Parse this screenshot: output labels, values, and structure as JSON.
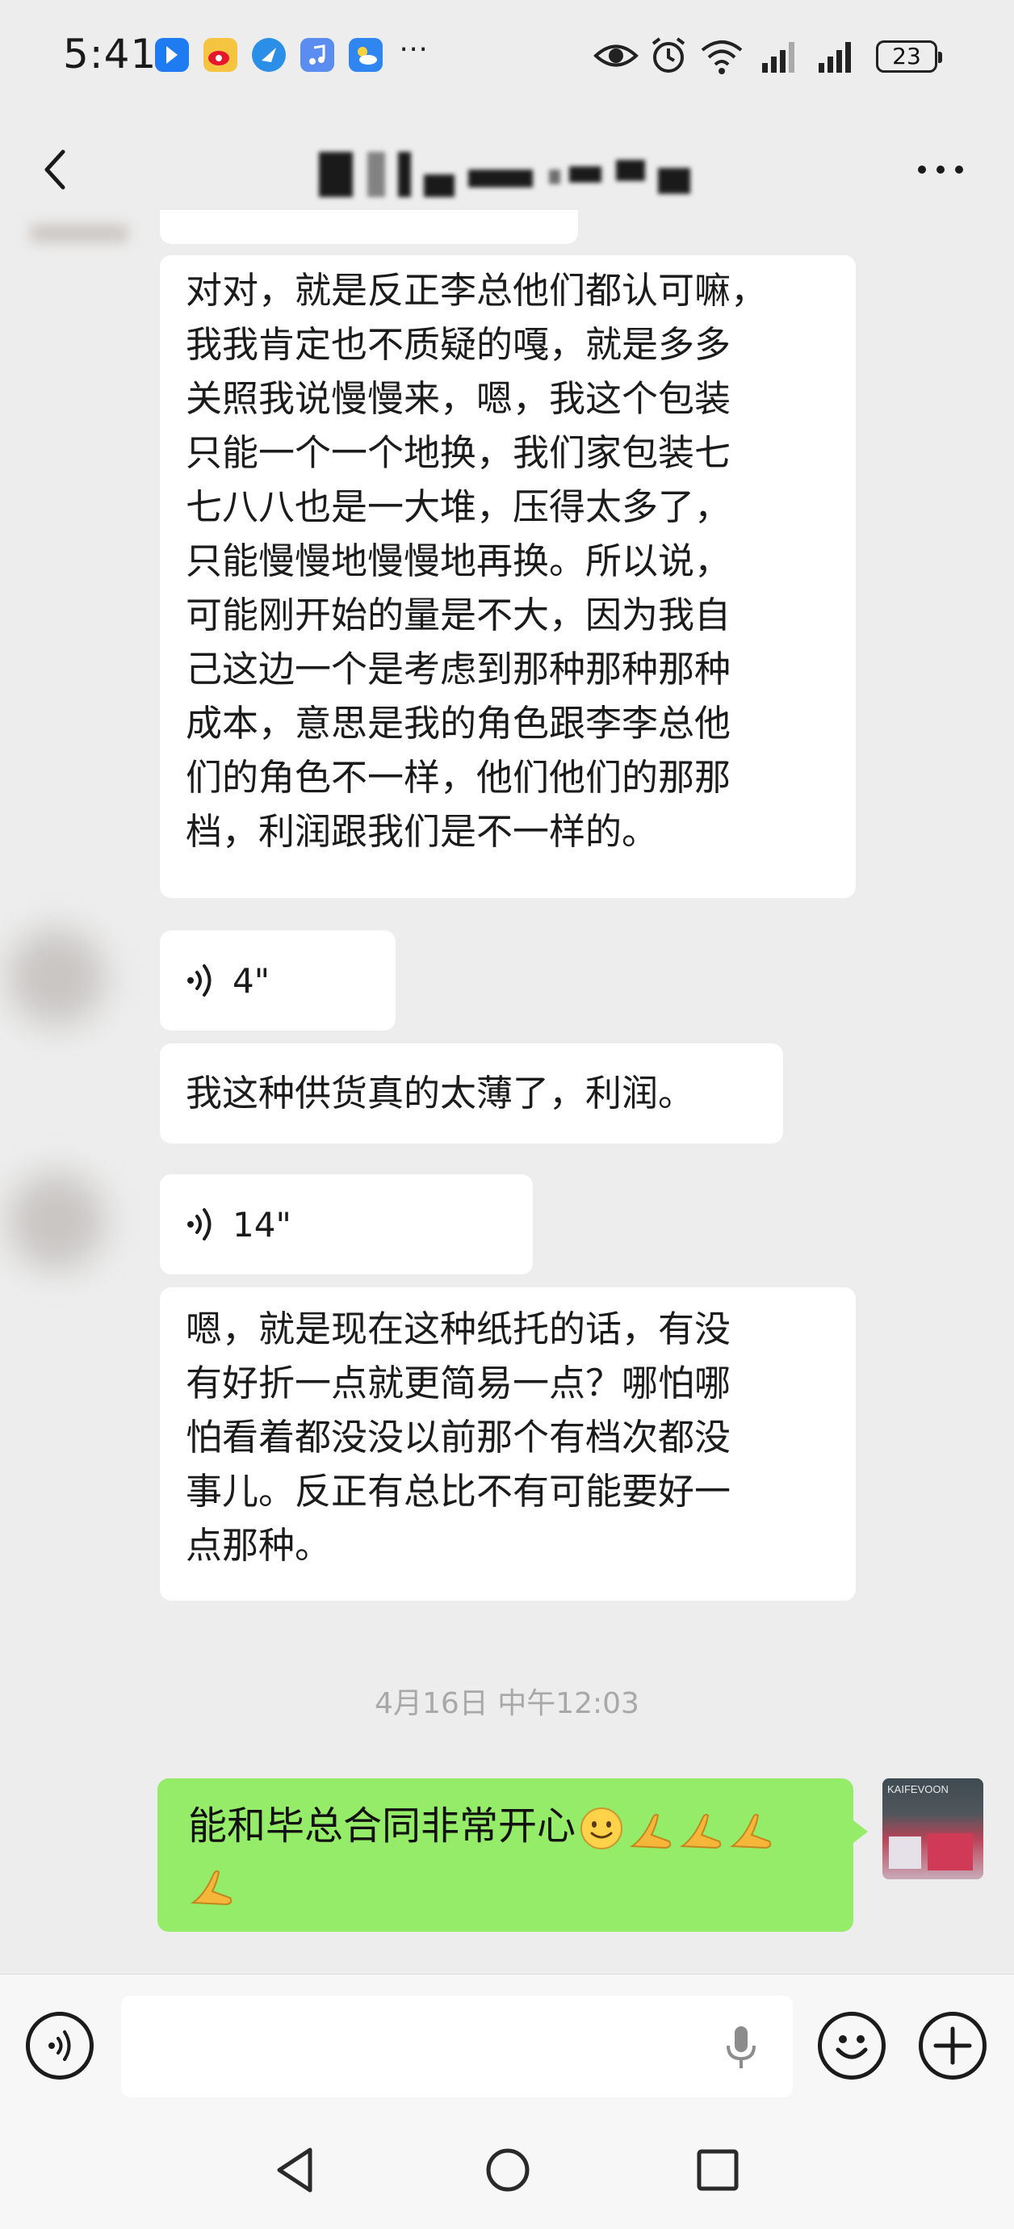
{
  "status_bar": {
    "time": "5:41",
    "battery": "23",
    "icons": [
      "bluetooth-app-icon",
      "weibo-icon",
      "browser-icon",
      "music-icon",
      "weather-icon",
      "more-dots",
      "eye-icon",
      "alarm-icon",
      "wifi-icon",
      "signal-icon",
      "signal-icon"
    ]
  },
  "header": {
    "back_icon": "chevron-left-icon",
    "more_icon": "more-horizontal-icon"
  },
  "messages": {
    "msg1": "对对，就是反正李总他们都认可嘛，\n我我肯定也不质疑的嘎，就是多多\n关照我说慢慢来，嗯，我这个包装\n只能一个一个地换，我们家包装七\n七八八也是一大堆，压得太多了，\n只能慢慢地慢慢地再换。所以说，\n可能刚开始的量是不大，因为我自\n己这边一个是考虑到那种那种那种\n成本，意思是我的角色跟李李总他\n们的角色不一样，他们他们的那那\n档，利润跟我们是不一样的。",
    "voice1": "4\"",
    "msg2": "我这种供货真的太薄了，利润。",
    "voice2": "14\"",
    "msg3": "嗯，就是现在这种纸托的话，有没\n有好折一点就更简易一点？哪怕哪\n怕看着都没没以前那个有档次都没\n事儿。反正有总比不有可能要好一\n点那种。",
    "timestamp": "4月16日 中午12:03",
    "my_msg": "能和毕总合同非常开心"
  },
  "my_avatar_text": "KAIFEVOON",
  "colors": {
    "background": "#ededed",
    "sent_bubble": "#95ec69",
    "received_bubble": "#ffffff"
  }
}
